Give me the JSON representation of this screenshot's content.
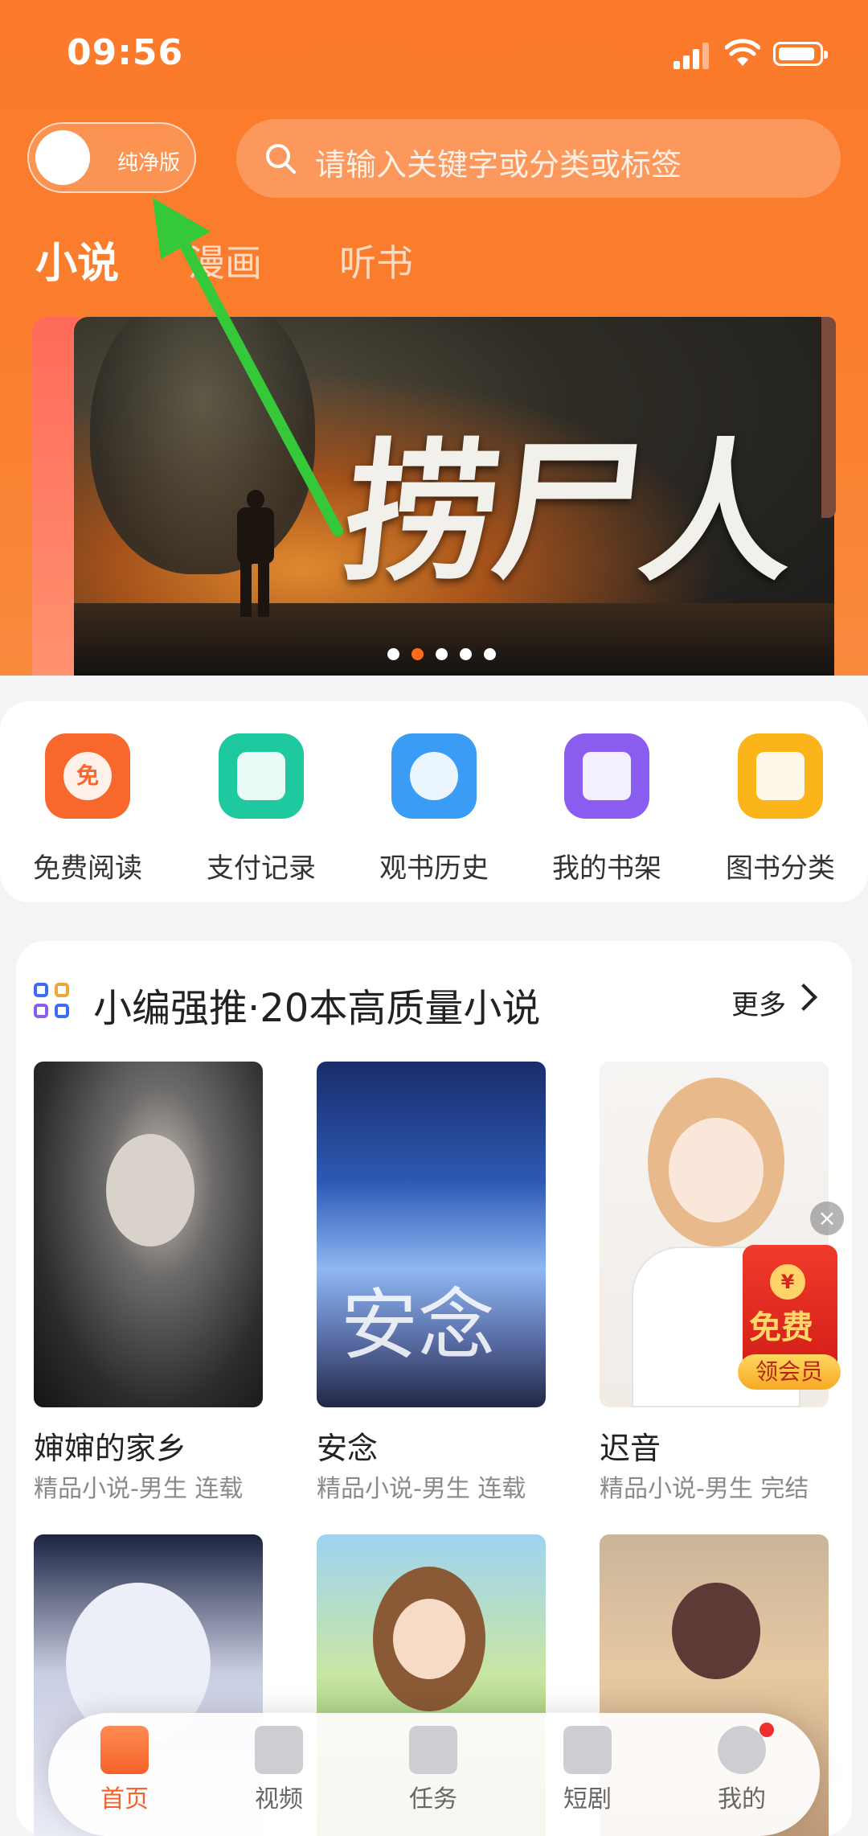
{
  "status_bar": {
    "time": "09:56"
  },
  "top": {
    "toggle_label": "纯净版",
    "search_placeholder": "请输入关键字或分类或标签"
  },
  "tabs": [
    {
      "label": "小说",
      "active": true
    },
    {
      "label": "漫画",
      "active": false
    },
    {
      "label": "听书",
      "active": false
    }
  ],
  "banner": {
    "title": "捞尸人",
    "dot_count": 5,
    "active_dot": 2
  },
  "shortcuts": [
    {
      "label": "免费阅读",
      "icon": "free-read-icon",
      "icon_text": "免",
      "color": "#f8682d"
    },
    {
      "label": "支付记录",
      "icon": "payment-record-icon",
      "icon_text": "",
      "color": "#1ec9a0"
    },
    {
      "label": "观书历史",
      "icon": "history-clock-icon",
      "icon_text": "",
      "color": "#3b9cf5"
    },
    {
      "label": "我的书架",
      "icon": "bookshelf-icon",
      "icon_text": "",
      "color": "#8b5cf0"
    },
    {
      "label": "图书分类",
      "icon": "category-book-icon",
      "icon_text": "",
      "color": "#fbb41a"
    }
  ],
  "recommend": {
    "heading": "小编强推·20本高质量小说",
    "more_label": "更多",
    "books": [
      {
        "title": "婶婶的家乡",
        "meta": "精品小说-男生 连载"
      },
      {
        "title": "安念",
        "meta": "精品小说-男生 连载",
        "cover_text": "安念"
      },
      {
        "title": "迟音",
        "meta": "精品小说-男生 完结"
      },
      {
        "title": "",
        "meta": ""
      },
      {
        "title": "",
        "meta": ""
      },
      {
        "title": "",
        "meta": ""
      }
    ]
  },
  "promo": {
    "coin": "¥",
    "title": "免费",
    "action": "领会员",
    "close": "×"
  },
  "bottom_nav": [
    {
      "label": "首页",
      "icon": "home-book-icon",
      "active": true
    },
    {
      "label": "视频",
      "icon": "video-play-icon",
      "active": false
    },
    {
      "label": "任务",
      "icon": "gift-icon",
      "active": false
    },
    {
      "label": "短剧",
      "icon": "film-icon",
      "active": false
    },
    {
      "label": "我的",
      "icon": "user-icon",
      "active": false,
      "badge": true
    }
  ],
  "colors": {
    "brand": "#fa7a2c",
    "accent": "#f5622a",
    "annotation_arrow": "#35c93a"
  }
}
